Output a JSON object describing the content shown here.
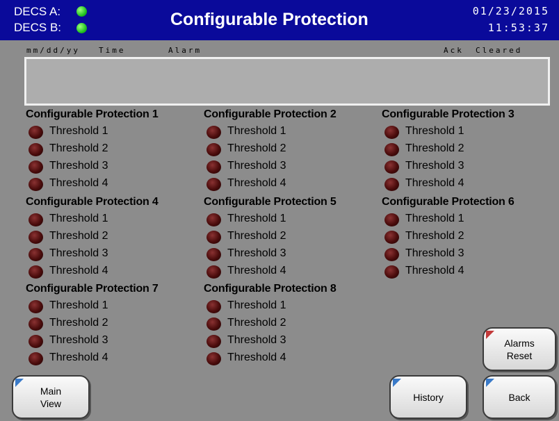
{
  "header": {
    "decs_a_label": "DECS A:",
    "decs_b_label": "DECS B:",
    "decs_a_status_color": "#22c322",
    "decs_b_status_color": "#22c322",
    "title": "Configurable Protection",
    "date": "01/23/2015",
    "time": "11:53:37"
  },
  "alarm_log": {
    "columns": {
      "date": "mm/dd/yy",
      "time": "Time",
      "alarm": "Alarm",
      "ack": "Ack",
      "cleared": "Cleared"
    },
    "entries": []
  },
  "indicator_color": "#4a0c0c",
  "groups": [
    {
      "title": "Configurable Protection 1",
      "thresholds": [
        "Threshold 1",
        "Threshold 2",
        "Threshold 3",
        "Threshold 4"
      ]
    },
    {
      "title": "Configurable Protection 2",
      "thresholds": [
        "Threshold 1",
        "Threshold 2",
        "Threshold 3",
        "Threshold 4"
      ]
    },
    {
      "title": "Configurable Protection 3",
      "thresholds": [
        "Threshold 1",
        "Threshold 2",
        "Threshold 3",
        "Threshold 4"
      ]
    },
    {
      "title": "Configurable Protection 4",
      "thresholds": [
        "Threshold 1",
        "Threshold 2",
        "Threshold 3",
        "Threshold 4"
      ]
    },
    {
      "title": "Configurable Protection 5",
      "thresholds": [
        "Threshold 1",
        "Threshold 2",
        "Threshold 3",
        "Threshold 4"
      ]
    },
    {
      "title": "Configurable Protection 6",
      "thresholds": [
        "Threshold 1",
        "Threshold 2",
        "Threshold 3",
        "Threshold 4"
      ]
    },
    {
      "title": "Configurable Protection 7",
      "thresholds": [
        "Threshold 1",
        "Threshold 2",
        "Threshold 3",
        "Threshold 4"
      ]
    },
    {
      "title": "Configurable Protection 8",
      "thresholds": [
        "Threshold 1",
        "Threshold 2",
        "Threshold 3",
        "Threshold 4"
      ]
    }
  ],
  "buttons": {
    "alarms_reset_line1": "Alarms",
    "alarms_reset_line2": "Reset",
    "main_view_line1": "Main",
    "main_view_line2": "View",
    "history": "History",
    "back": "Back"
  }
}
